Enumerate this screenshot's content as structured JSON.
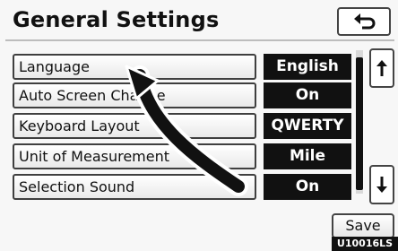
{
  "header": {
    "title": "General Settings",
    "back_icon": "return-arrow-icon"
  },
  "settings": [
    {
      "label": "Language",
      "value": "English"
    },
    {
      "label": "Auto Screen Change",
      "value": "On"
    },
    {
      "label": "Keyboard Layout",
      "value": "QWERTY"
    },
    {
      "label": "Unit of Measurement",
      "value": "Mile"
    },
    {
      "label": "Selection Sound",
      "value": "On"
    }
  ],
  "scroll": {
    "up_icon": "scroll-up-icon",
    "down_icon": "scroll-down-icon"
  },
  "footer": {
    "save_label": "Save",
    "code": "U10016LS"
  },
  "colors": {
    "value_bg": "#111111",
    "value_text": "#ffffff",
    "button_border": "#3f3f3f"
  }
}
